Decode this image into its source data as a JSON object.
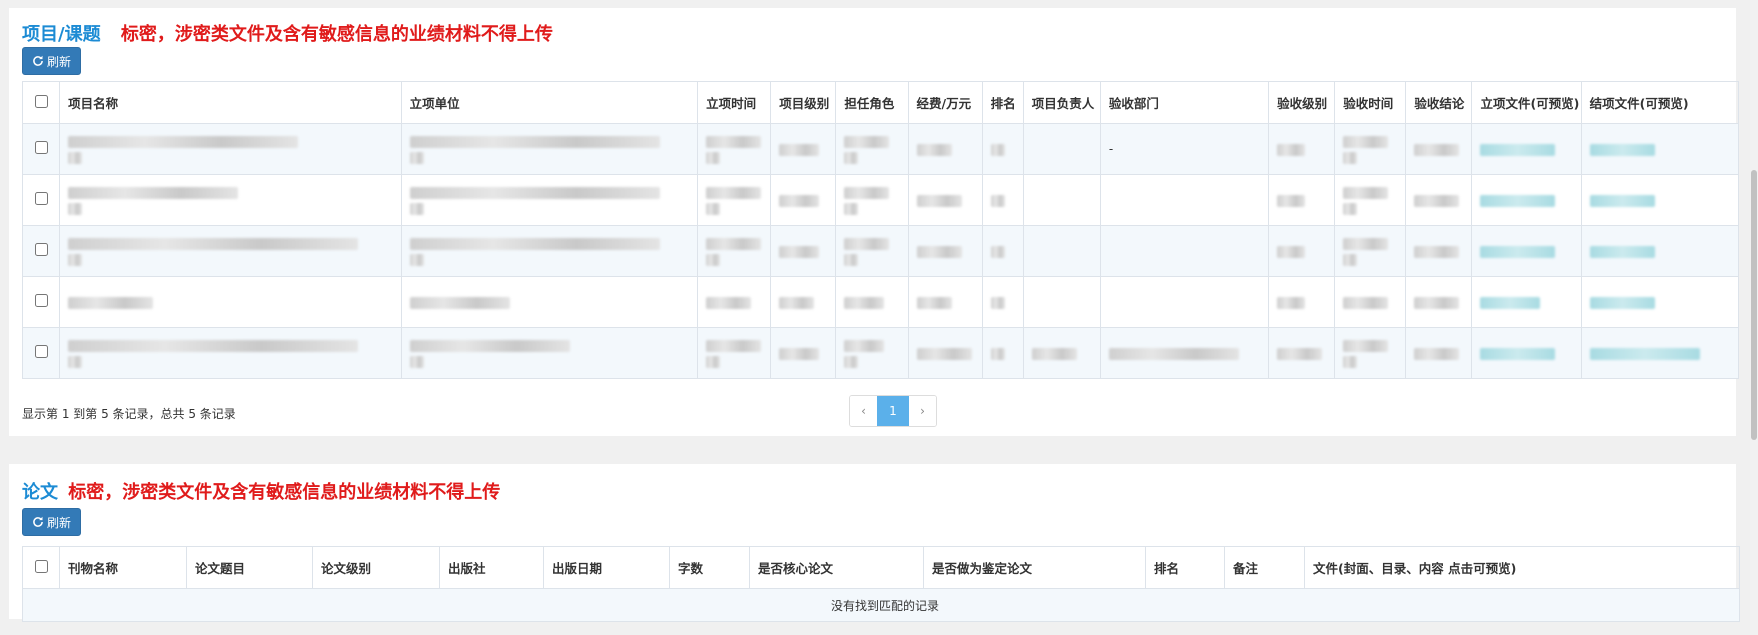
{
  "projects": {
    "title": "项目/课题",
    "warning": "标密，涉密类文件及含有敏感信息的业绩材料不得上传",
    "refresh_label": "刷新",
    "columns": [
      "项目名称",
      "立项单位",
      "立项时间",
      "项目级别",
      "担任角色",
      "经费/万元",
      "排名",
      "项目负责人",
      "验收部门",
      "验收级别",
      "验收时间",
      "验收结论",
      "立项文件(可预览)",
      "结项文件(可预览)"
    ],
    "row_count": 5,
    "visible_values": [
      "-"
    ],
    "pager_info": "显示第 1 到第 5 条记录，总共 5 条记录",
    "pagination": {
      "prev": "‹",
      "current": "1",
      "next": "›"
    }
  },
  "papers": {
    "title": "论文",
    "warning": "标密，涉密类文件及含有敏感信息的业绩材料不得上传",
    "refresh_label": "刷新",
    "columns": [
      "刊物名称",
      "论文题目",
      "论文级别",
      "出版社",
      "出版日期",
      "字数",
      "是否核心论文",
      "是否做为鉴定论文",
      "排名",
      "备注",
      "文件(封面、目录、内容 点击可预览)"
    ],
    "empty_text": "没有找到匹配的记录"
  },
  "colors": {
    "title_blue": "#1c8bd4",
    "warning_red": "#e01b1b",
    "button_bg": "#337ab7",
    "pager_active": "#5bb0ea"
  },
  "icons": {
    "refresh": "refresh-icon"
  }
}
